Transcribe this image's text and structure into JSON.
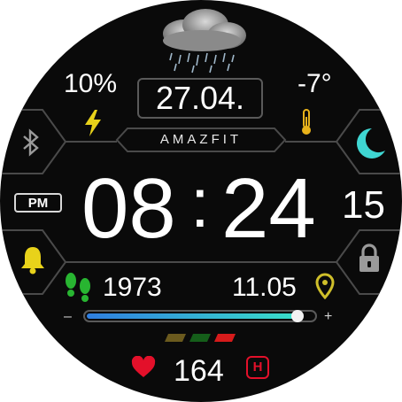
{
  "watch": {
    "brand": "AMAZFIT",
    "battery": "10%",
    "temperature": "-7°",
    "date": "27.04.",
    "am_pm": "PM",
    "hours": "08",
    "separator": ":",
    "minutes": "24",
    "seconds": "15",
    "steps": "1973",
    "distance": "11.05",
    "heart_rate": "164",
    "hr_badge": "H",
    "progress_minus": "–",
    "progress_plus": "+",
    "progress_fraction": 0.93
  },
  "icons": {
    "weather": "rain-cloud-icon",
    "battery": "lightning-icon",
    "temperature": "thermometer-icon",
    "bluetooth": "bluetooth-icon",
    "night_mode": "moon-icon",
    "alarm": "bell-icon",
    "lock": "lock-icon",
    "steps": "footprints-icon",
    "distance": "location-pin-icon",
    "heart": "heart-icon"
  },
  "colors": {
    "background": "#0a0a0a",
    "accent_yellow": "#e8d21a",
    "accent_cyan": "#3fd6d2",
    "steps_green": "#28b531",
    "heart_red": "#e3102a",
    "progress_start": "#2f7ee0",
    "progress_end": "#39dfc9",
    "indicator_colors": [
      "#6b5a1e",
      "#155e1a",
      "#d61b1b"
    ]
  }
}
